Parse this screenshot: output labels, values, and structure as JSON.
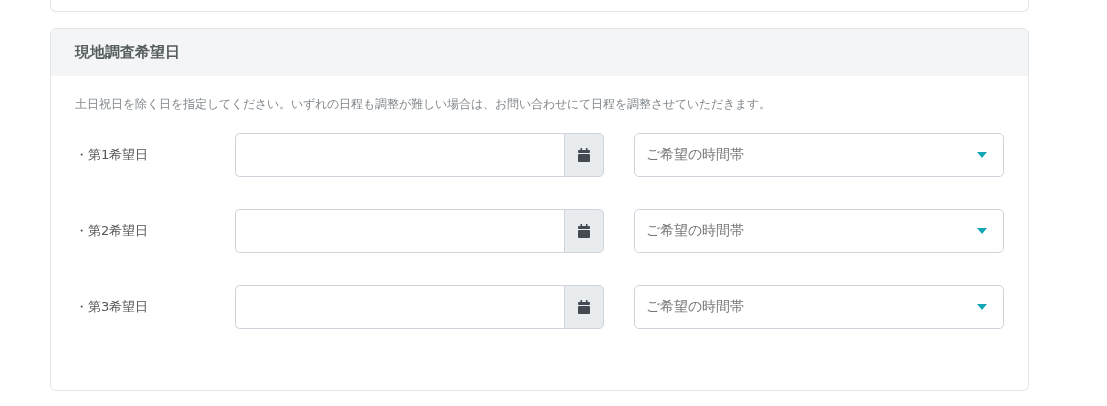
{
  "section": {
    "title": "現地調査希望日",
    "note": "土日祝日を除く日を指定してください。いずれの日程も調整が難しい場合は、お問い合わせにて日程を調整させていただきます。",
    "rows": [
      {
        "label": "・第1希望日",
        "time_placeholder": "ご希望の時間帯"
      },
      {
        "label": "・第2希望日",
        "time_placeholder": "ご希望の時間帯"
      },
      {
        "label": "・第3希望日",
        "time_placeholder": "ご希望の時間帯"
      }
    ]
  }
}
